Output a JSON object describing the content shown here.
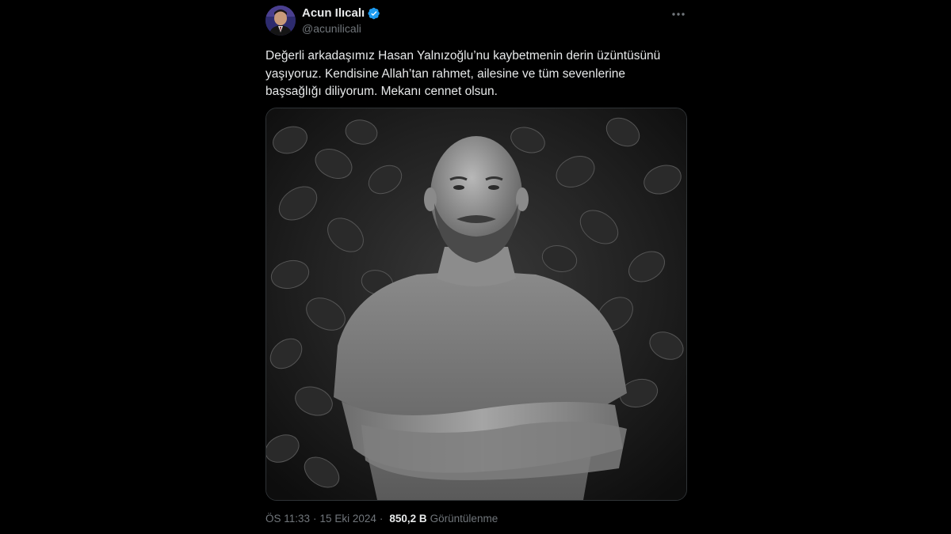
{
  "author": {
    "display_name": "Acun Ilıcalı",
    "handle": "@acunilicali",
    "verified": true
  },
  "tweet": {
    "text": "Değerli arkadaşımız Hasan Yalnızoğlu’nu kaybetmenin derin üzüntüsünü\nyaşıyoruz. Kendisine Allah’tan rahmet, ailesine ve tüm sevenlerine\nbaşsağlığı diliyorum. Mekanı cennet olsun."
  },
  "meta": {
    "time": "ÖS 11:33",
    "separator": "·",
    "date": "15 Eki 2024",
    "views_count": "850,2 B",
    "views_label": "Görüntülenme"
  },
  "colors": {
    "background": "#000000",
    "text": "#e7e9ea",
    "secondary_text": "#71767b",
    "verified_badge": "#1d9bf0",
    "border": "#2f3336"
  },
  "icons": {
    "verified": "verified-badge-icon",
    "more": "more-options-icon"
  }
}
